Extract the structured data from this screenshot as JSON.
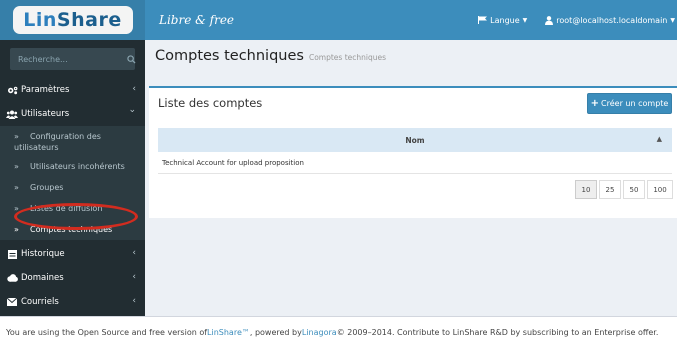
{
  "sidebar": {
    "logo": {
      "part1": "Lin",
      "part2": "Share"
    },
    "search_placeholder": "Recherche...",
    "items": [
      {
        "label": "Paramètres",
        "icon": "cogs-icon",
        "chevron": "‹"
      },
      {
        "label": "Utilisateurs",
        "icon": "users-icon",
        "chevron": "⌄"
      },
      {
        "label": "Historique",
        "icon": "history-icon",
        "chevron": "‹"
      },
      {
        "label": "Domaines",
        "icon": "cloud-icon",
        "chevron": "‹"
      },
      {
        "label": "Courriels",
        "icon": "envelope-icon",
        "chevron": "‹"
      }
    ],
    "subitems": [
      {
        "label": "Configuration des utilisateurs"
      },
      {
        "label": "Utilisateurs incohérents"
      },
      {
        "label": "Groupes"
      },
      {
        "label": "Listes de diffusion"
      },
      {
        "label": "Comptes techniques"
      }
    ],
    "sub_arrow": "»"
  },
  "header": {
    "brand": "Libre & free",
    "language_label": "Langue",
    "user_label": "root@localhost.localdomain"
  },
  "content": {
    "title": "Comptes techniques",
    "subtitle": "Comptes techniques",
    "box_title": "Liste des comptes",
    "create_button": "Créer un compte",
    "table": {
      "column": "Nom",
      "rows": [
        "Technical Account for upload proposition"
      ]
    },
    "page_sizes": [
      "10",
      "25",
      "50",
      "100"
    ],
    "active_page_size": "10"
  },
  "footer": {
    "text1": "You are using the Open Source and free version of ",
    "link1": "LinShare™",
    "text2": ", powered by ",
    "link2": "Linagora",
    "text3": " © 2009–2014. Contribute to LinShare R&D by subscribing to an Enterprise offer."
  },
  "colors": {
    "brand_blue": "#3c8dbc",
    "sidebar_bg": "#222d32",
    "highlight_ring": "#d22c1f"
  }
}
